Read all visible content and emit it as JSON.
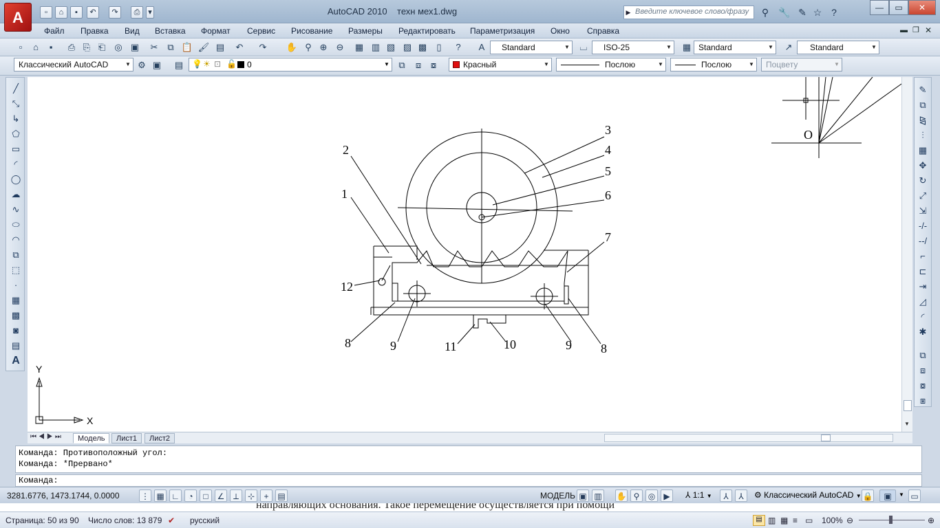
{
  "titlebar": {
    "app_name": "AutoCAD 2010",
    "file_name": "техн мех1.dwg",
    "search_placeholder": "Введите ключевое слово/фразу",
    "logo_letter": "A"
  },
  "menu": [
    "Файл",
    "Правка",
    "Вид",
    "Вставка",
    "Формат",
    "Сервис",
    "Рисование",
    "Размеры",
    "Редактировать",
    "Параметризация",
    "Окно",
    "Справка"
  ],
  "styles_toolbar": {
    "text_style": "Standard",
    "dim_style": "ISO-25",
    "table_style": "Standard",
    "mleader_style": "Standard"
  },
  "properties_toolbar": {
    "workspace": "Классический AutoCAD",
    "layer": "0",
    "color": "Красный",
    "color_hex": "#e01010",
    "linetype": "Послою",
    "lineweight": "Послою",
    "plotstyle": "Поцвету"
  },
  "drawing": {
    "labels": [
      "1",
      "2",
      "3",
      "4",
      "5",
      "6",
      "7",
      "8",
      "9",
      "10",
      "11",
      "12",
      "9",
      "8"
    ],
    "point_label": "O",
    "axis_x": "X",
    "axis_y": "Y"
  },
  "tabs": [
    "Модель",
    "Лист1",
    "Лист2"
  ],
  "command": {
    "history": [
      "Команда: Противоположный угол:",
      "Команда: *Прервано*"
    ],
    "prompt": "Команда:"
  },
  "status": {
    "coords": "3281.6776, 1473.1744, 0.0000",
    "model": "МОДЕЛЬ",
    "scale": "1:1",
    "workspace": "Классический AutoCAD"
  },
  "word": {
    "doc_text": "направляющих основания. Такое перемещение осуществляется при помощи",
    "page": "Страница: 50 из 90",
    "words": "Число слов: 13 879",
    "language": "русский",
    "zoom": "100%"
  }
}
